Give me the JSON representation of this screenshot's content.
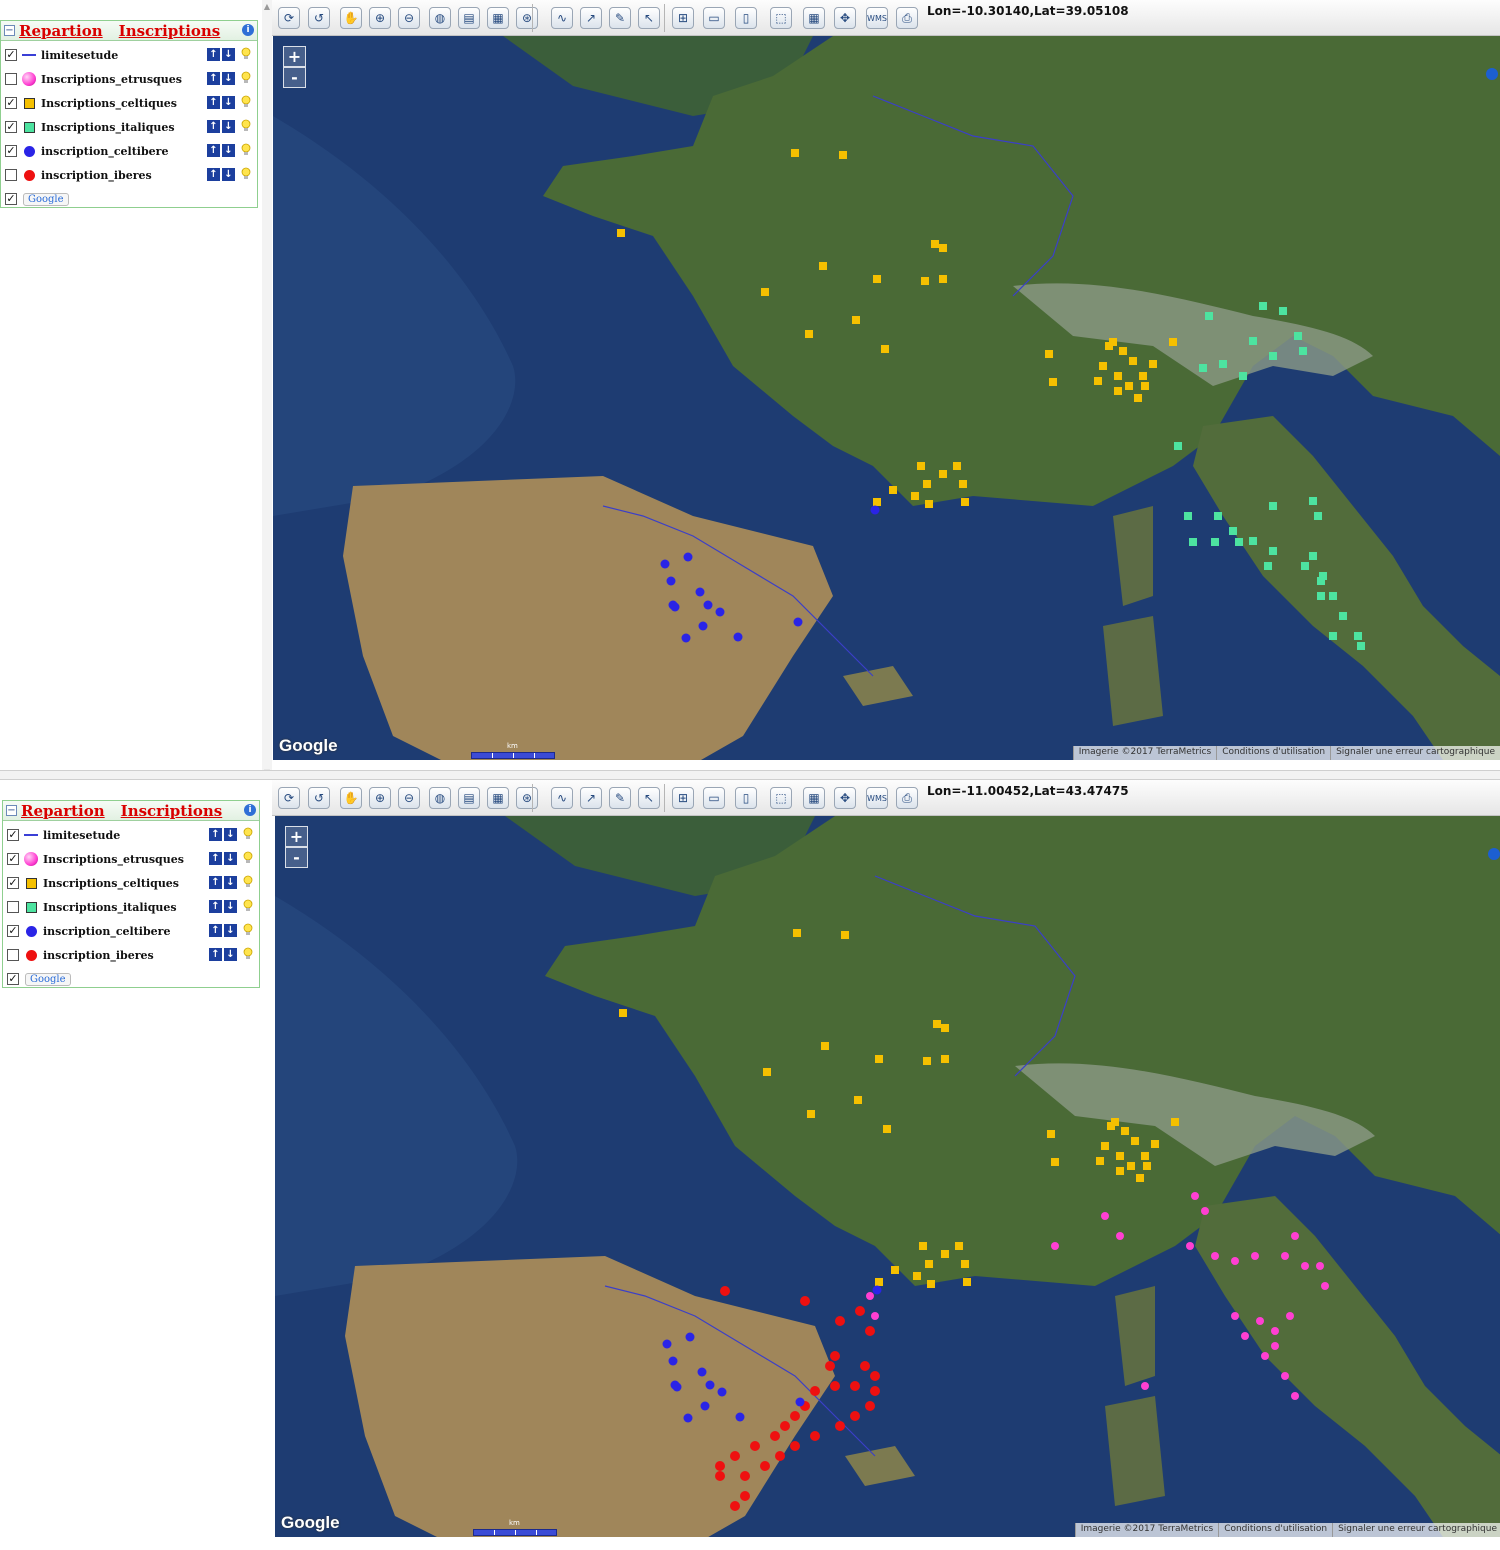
{
  "legend_title": {
    "left": "Repartion",
    "right": "Inscriptions"
  },
  "info_icon": "i",
  "collapse_symbol": "−",
  "layers": [
    {
      "label": "limitesetude",
      "symbol": "line",
      "color": "#3a3fd6"
    },
    {
      "label": "Inscriptions_etrusques",
      "symbol": "sphere",
      "color": "#ff3fd2"
    },
    {
      "label": "Inscriptions_celtiques",
      "symbol": "square",
      "color": "#f5c000"
    },
    {
      "label": "Inscriptions_italiques",
      "symbol": "square",
      "color": "#4de3a0"
    },
    {
      "label": "inscription_celtibere",
      "symbol": "dot",
      "color": "#2a24e6"
    },
    {
      "label": "inscription_iberes",
      "symbol": "dot",
      "color": "#ee1010"
    }
  ],
  "google_layer_label": "Google",
  "arrow_up": "↑",
  "arrow_down": "↓",
  "checkmark": "✓",
  "zoom_in": "+",
  "zoom_out": "-",
  "map_watermark": "Google",
  "scale": {
    "unit": "km",
    "ticks": [
      "0",
      "100",
      "200"
    ]
  },
  "attribution": [
    "Imagerie ©2017 TerraMetrics",
    "Conditions d'utilisation",
    "Signaler une erreur cartographique"
  ],
  "toolbar_icons": [
    "reload-icon",
    "undo-icon",
    "pan-icon",
    "zoom-in-icon",
    "zoom-out-icon",
    "globe-icon",
    "measure-icon",
    "grid-icon",
    "target-icon",
    "draw-line-icon",
    "draw-arrow-icon",
    "edit-icon",
    "select-icon",
    "add-layer-icon",
    "folder-icon",
    "book-icon",
    "region-icon",
    "table-icon",
    "extent-icon",
    "wms-icon",
    "print-icon"
  ],
  "wms_label": "WMS",
  "panels": [
    {
      "id": "top",
      "coords": "Lon=-10.30140,Lat=39.05108",
      "checked": [
        true,
        false,
        true,
        true,
        true,
        false,
        true
      ]
    },
    {
      "id": "bottom",
      "coords": "Lon=-11.00452,Lat=43.47475",
      "checked": [
        true,
        true,
        true,
        false,
        true,
        false,
        true
      ]
    }
  ]
}
